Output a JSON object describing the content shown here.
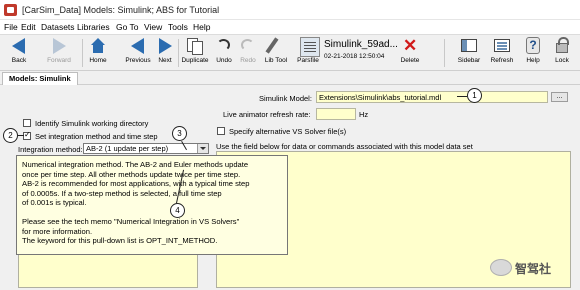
{
  "window": {
    "title": "[CarSim_Data] Models: Simulink; ABS for Tutorial"
  },
  "menu": {
    "items": [
      "File",
      "Edit",
      "Datasets",
      "Libraries",
      "Go To",
      "View",
      "Tools",
      "Help"
    ]
  },
  "toolbar": {
    "back_label": "Back",
    "forward_label": "Forward",
    "home_label": "Home",
    "previous_label": "Previous",
    "next_label": "Next",
    "duplicate_label": "Duplicate",
    "undo_label": "Undo",
    "redo_label": "Redo",
    "lib_tool_label": "Lib Tool",
    "parsfile_label": "Parsfile",
    "dataset_name": "Simulink_59ad...",
    "dataset_date": "02-21-2018 12:50:04",
    "delete_label": "Delete",
    "sidebar_label": "Sidebar",
    "refresh_label": "Refresh",
    "help_label": "Help",
    "lock_label": "Lock",
    "help_glyph": "?",
    "delete_glyph": "✕"
  },
  "tabs": {
    "active": "Models: Simulink"
  },
  "form": {
    "simulink_model_label": "Simulink Model:",
    "simulink_model_value": "Extensions\\Simulink\\abs_tutorial.mdl",
    "browse_label": "...",
    "refresh_rate_label": "Live animator refresh rate:",
    "refresh_rate_value": "",
    "refresh_rate_unit": "Hz",
    "identify_label": "Identify Simulink working directory",
    "identify_checked": false,
    "set_integration_label": "Set integration method and time step",
    "set_integration_checked": true,
    "specify_solver_label": "Specify alternative VS Solver file(s)",
    "specify_solver_checked": false,
    "hint_text": "Use the field below for data or commands associated with this model data set",
    "integration_method_label": "Integration method:",
    "integration_method_value": "AB-2 (1 update per step)"
  },
  "tooltip": {
    "lines": [
      "Numerical integration method. The AB-2 and Euler methods update",
      "once per time step. All other methods update twice per time step.",
      "AB-2 is recommended for most applications, with a typical time step",
      "of 0.0005s. If a two-step method is selected, a full time step",
      "of 0.001s is typical.",
      "",
      "Please see the tech memo \"Numerical Integration in VS Solvers\"",
      "for more information.",
      "The keyword for this pull-down list is OPT_INT_METHOD."
    ]
  },
  "callouts": [
    "1",
    "2",
    "3",
    "4"
  ],
  "watermark": {
    "text": "智驾社"
  },
  "colors": {
    "field_yellow": "#ffffcc",
    "tooltip_bg": "#ffffe1",
    "toolbar_bg": "#f0f0f0",
    "accent_blue": "#2b6cb0",
    "delete_red": "#d11a1a"
  }
}
